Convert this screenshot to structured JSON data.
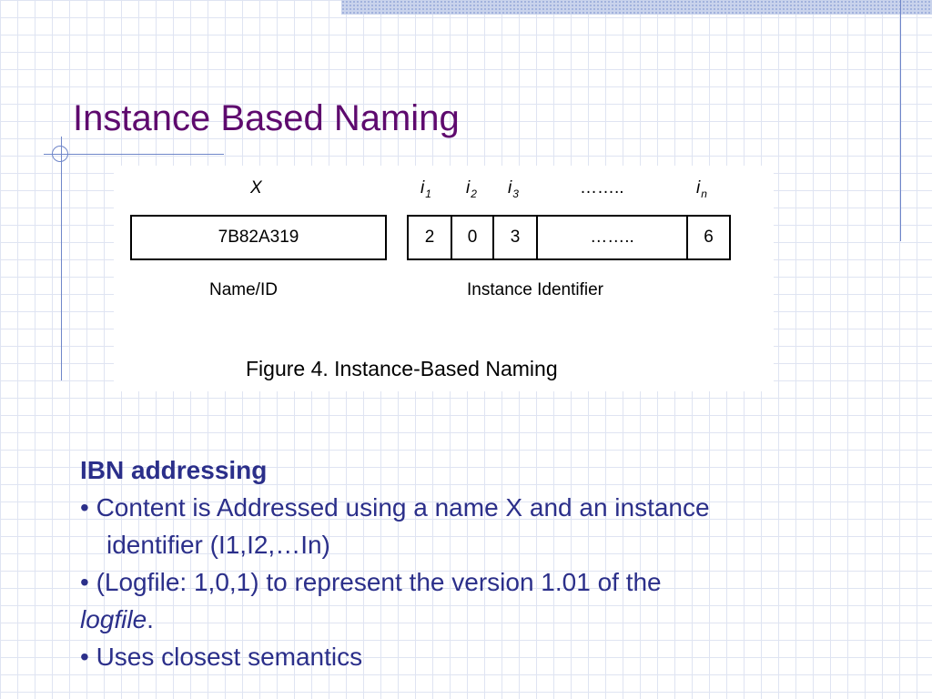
{
  "title": "Instance Based Naming",
  "figure": {
    "header_x": "X",
    "header_i_letter": "i",
    "header_subs": [
      "1",
      "2",
      "3"
    ],
    "header_dots": "……..",
    "header_n_sub": "n",
    "name_value": "7B82A319",
    "instance_cells": [
      "2",
      "0",
      "3",
      "……..",
      "6"
    ],
    "label_name": "Name/ID",
    "label_instance": "Instance Identifier",
    "caption": "Figure 4. Instance-Based Naming"
  },
  "body": {
    "heading": "IBN addressing",
    "bullet1_line1": "• Content is Addressed using a name X and an instance",
    "bullet1_line2": "identifier (I1,I2,…In)",
    "bullet2_line1": "• (Logfile: 1,0,1) to represent the version 1.01 of the",
    "bullet2_italic": "logfile",
    "bullet2_end": ".",
    "bullet3": "• Uses closest semantics"
  }
}
